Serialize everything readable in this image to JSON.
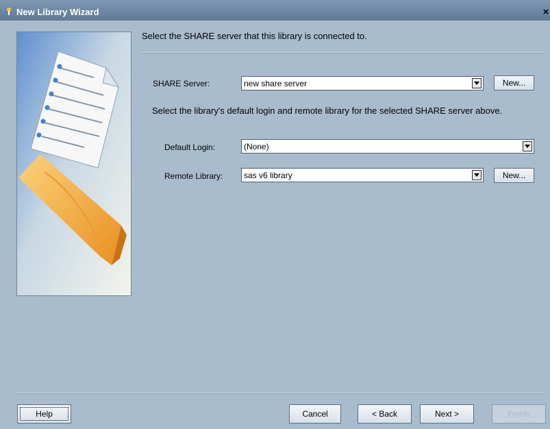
{
  "window": {
    "title": "New Library Wizard",
    "close_label": "×"
  },
  "heading": "Select the SHARE server that this library is connected to.",
  "share_server": {
    "label": "SHARE Server:",
    "value": "new share server",
    "new_button": "New..."
  },
  "description": "Select the library's default login and remote library for the selected SHARE server above.",
  "default_login": {
    "label": "Default Login:",
    "value": "(None)"
  },
  "remote_library": {
    "label": "Remote Library:",
    "value": "sas v6 library",
    "new_button": "New..."
  },
  "buttons": {
    "help": "Help",
    "cancel": "Cancel",
    "back": "< Back",
    "next": "Next >",
    "finish": "Finish"
  },
  "colors": {
    "background": "#a8bccd",
    "titlebar": "#6f8aa6",
    "accent_orange": "#f2a23a"
  }
}
